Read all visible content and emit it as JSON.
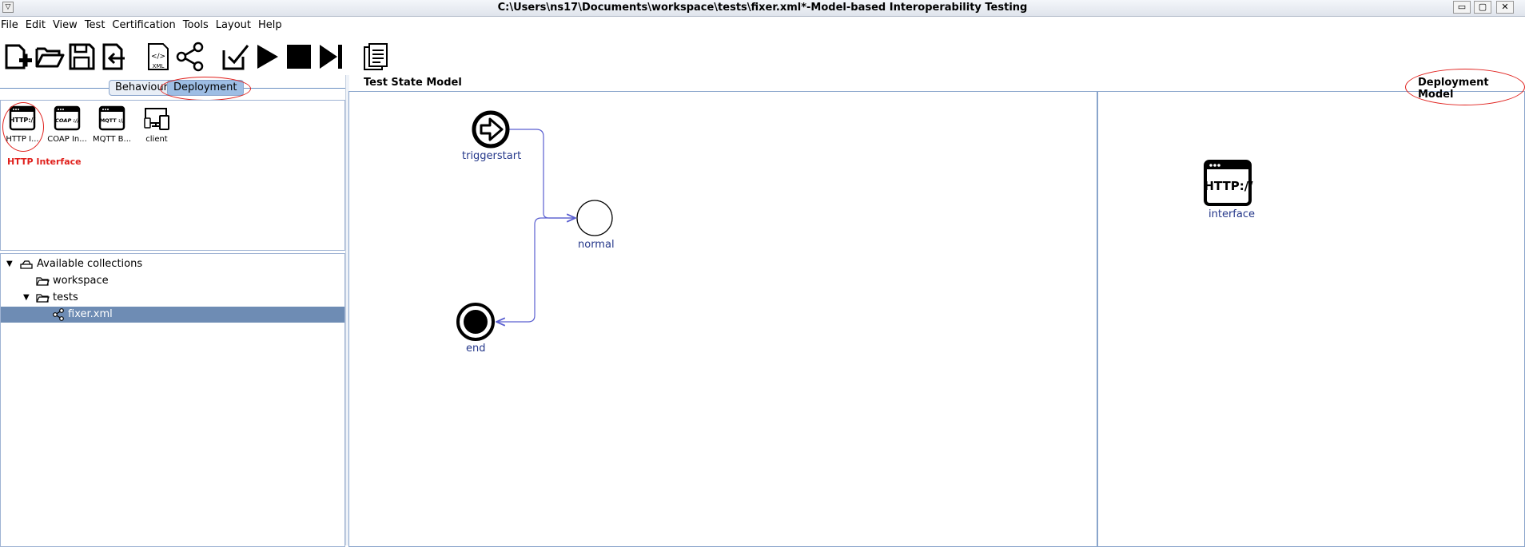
{
  "window": {
    "title": "C:\\Users\\ns17\\Documents\\workspace\\tests\\fixer.xml*-Model-based Interoperability Testing",
    "sysmenu_glyph": "▽",
    "minimize_glyph": "▭",
    "restore_glyph": "▢",
    "close_glyph": "✕"
  },
  "menubar": {
    "items": [
      "File",
      "Edit",
      "View",
      "Test",
      "Certification",
      "Tools",
      "Layout",
      "Help"
    ]
  },
  "toolbar": {
    "buttons": [
      {
        "name": "new-icon"
      },
      {
        "name": "open-folder-icon"
      },
      {
        "name": "save-icon"
      },
      {
        "name": "import-icon"
      },
      {
        "name": "xml-icon",
        "badge": "XML"
      },
      {
        "name": "share-graph-icon"
      },
      {
        "name": "check-icon"
      },
      {
        "name": "play-icon"
      },
      {
        "name": "stop-icon"
      },
      {
        "name": "step-icon"
      },
      {
        "name": "report-icon"
      }
    ]
  },
  "left_tabs": {
    "items": [
      "Behaviour",
      "Deployment"
    ],
    "active": "Deployment"
  },
  "palette": {
    "items": [
      {
        "label": "HTTP I...",
        "icon_text": "HTTP://",
        "icon": "http-interface-icon"
      },
      {
        "label": "COAP In...",
        "icon_text": "COAP ://",
        "icon": "coap-interface-icon"
      },
      {
        "label": "MQTT B...",
        "icon_text": "MQTT ://",
        "icon": "mqtt-broker-icon"
      },
      {
        "label": "client",
        "icon": "client-devices-icon"
      }
    ],
    "selected_description": "HTTP Interface"
  },
  "tree": {
    "rows": [
      {
        "label": "Available collections",
        "toggle": "▼",
        "icon": "collections-icon"
      },
      {
        "label": "workspace",
        "toggle": "",
        "icon": "folder-icon"
      },
      {
        "label": "tests",
        "toggle": "▼",
        "icon": "folder-icon"
      },
      {
        "label": "fixer.xml",
        "toggle": "",
        "icon": "graph-file-icon",
        "selected": true
      }
    ]
  },
  "test_state_model": {
    "header": "Test State Model",
    "nodes": [
      {
        "label": "triggerstart",
        "kind": "start"
      },
      {
        "label": "normal",
        "kind": "state"
      },
      {
        "label": "end",
        "kind": "end"
      }
    ],
    "edge_color": "#5a5fd0"
  },
  "deployment_model": {
    "header": "Deployment Model",
    "nodes": [
      {
        "label": "interface",
        "icon_text": "HTTP://",
        "icon": "http-interface-icon"
      }
    ]
  },
  "annotation_color": "#e0201c"
}
